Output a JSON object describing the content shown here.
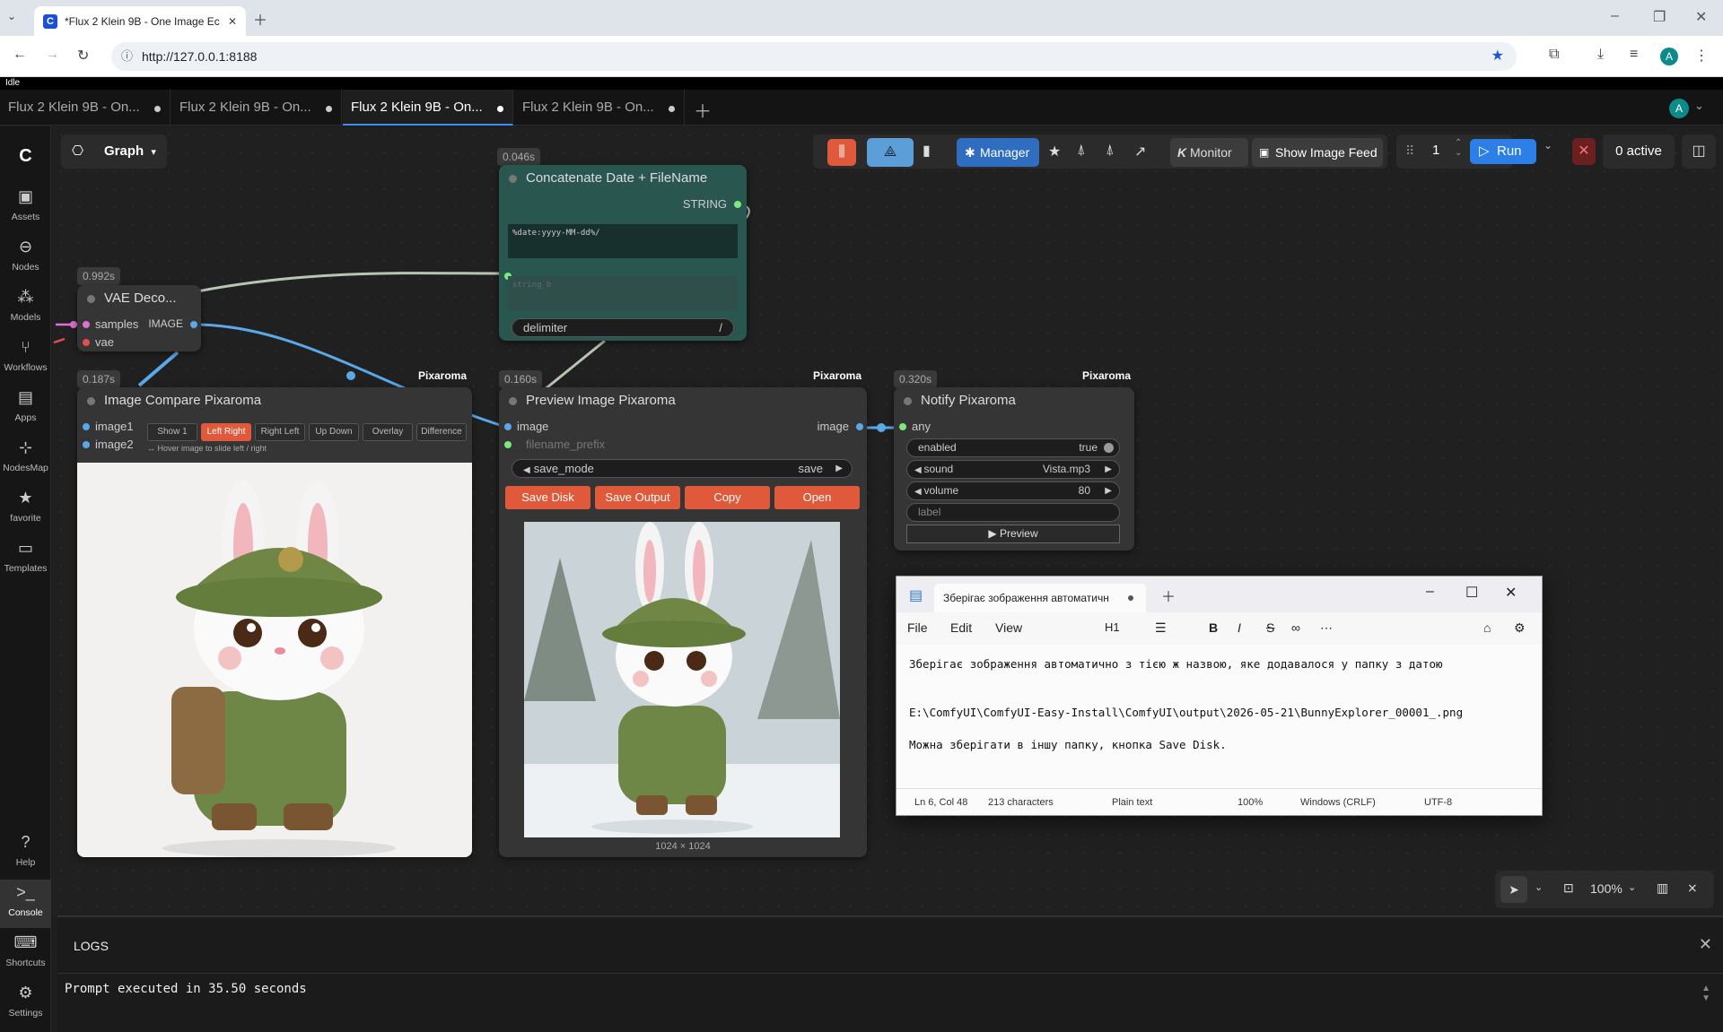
{
  "browser": {
    "tab_title": "*Flux 2 Klein 9B - One Image Ec",
    "url": "http://127.0.0.1:8188",
    "profile": "A"
  },
  "app": {
    "status": "Idle",
    "workflow_tabs": [
      "Flux 2 Klein 9B - On...",
      "Flux 2 Klein 9B - On...",
      "Flux 2 Klein 9B - On...",
      "Flux 2 Klein 9B - On..."
    ],
    "active_tab": 2,
    "user": "A",
    "graph_label": "Graph"
  },
  "sidebar": {
    "items": [
      "Assets",
      "Nodes",
      "Models",
      "Workflows",
      "Apps",
      "NodesMap",
      "favorite",
      "Templates"
    ],
    "help": "Help",
    "console": "Console",
    "shortcuts": "Shortcuts",
    "settings": "Settings"
  },
  "toolbar": {
    "manager": "Manager",
    "monitor": "Monitor",
    "monitor_prefix": "K",
    "image_feed": "Show Image Feed",
    "queue_count": "1",
    "run": "Run",
    "active": "0 active"
  },
  "nodes": {
    "concat": {
      "time": "0.046s",
      "title": "Concatenate Date + FileName",
      "output": "STRING",
      "text1": "%date:yyyy-MM-dd%/",
      "text2": "string_b",
      "delimiter_label": "delimiter",
      "delimiter_value": "/"
    },
    "vae": {
      "time": "0.992s",
      "title": "VAE Deco...",
      "in1": "samples",
      "in2": "vae",
      "out": "IMAGE"
    },
    "compare": {
      "time": "0.187s",
      "tag": "Pixaroma",
      "title": "Image Compare Pixaroma",
      "in1": "image1",
      "in2": "image2",
      "modes": [
        "Show 1",
        "Left Right",
        "Right Left",
        "Up Down",
        "Overlay",
        "Difference"
      ],
      "hint": "↔ Hover image to slide left / right"
    },
    "preview": {
      "time": "0.160s",
      "tag": "Pixaroma",
      "title": "Preview Image Pixaroma",
      "in1": "image",
      "in2": "filename_prefix",
      "out": "image",
      "save_mode_label": "save_mode",
      "save_mode_value": "save",
      "buttons": [
        "Save Disk",
        "Save Output",
        "Copy",
        "Open"
      ],
      "dims": "1024 × 1024"
    },
    "notify": {
      "time": "0.320s",
      "tag": "Pixaroma",
      "title": "Notify Pixaroma",
      "in1": "any",
      "enabled_label": "enabled",
      "enabled_value": "true",
      "sound_label": "sound",
      "sound_value": "Vista.mp3",
      "volume_label": "volume",
      "volume_value": "80",
      "label": "label",
      "preview": "▶ Preview"
    }
  },
  "notepad": {
    "tab": "Зберігає зображення автоматичн",
    "menu": [
      "File",
      "Edit",
      "View"
    ],
    "heading": "H1",
    "line1": "Зберігає зображення автоматично з тією ж назвою, яке додавалося у папку з датою",
    "line2": "E:\\ComfyUI\\ComfyUI-Easy-Install\\ComfyUI\\output\\2026-05-21\\BunnyExplorer_00001_.png",
    "line3": "Можна зберігати в іншу папку, кнопка Save Disk.",
    "status": [
      "Ln 6, Col 48",
      "213 characters",
      "Plain text",
      "100%",
      "Windows (CRLF)",
      "UTF-8"
    ]
  },
  "canvas_controls": {
    "zoom": "100%"
  },
  "logs": {
    "title": "LOGS",
    "text": "Prompt executed in 35.50 seconds"
  }
}
